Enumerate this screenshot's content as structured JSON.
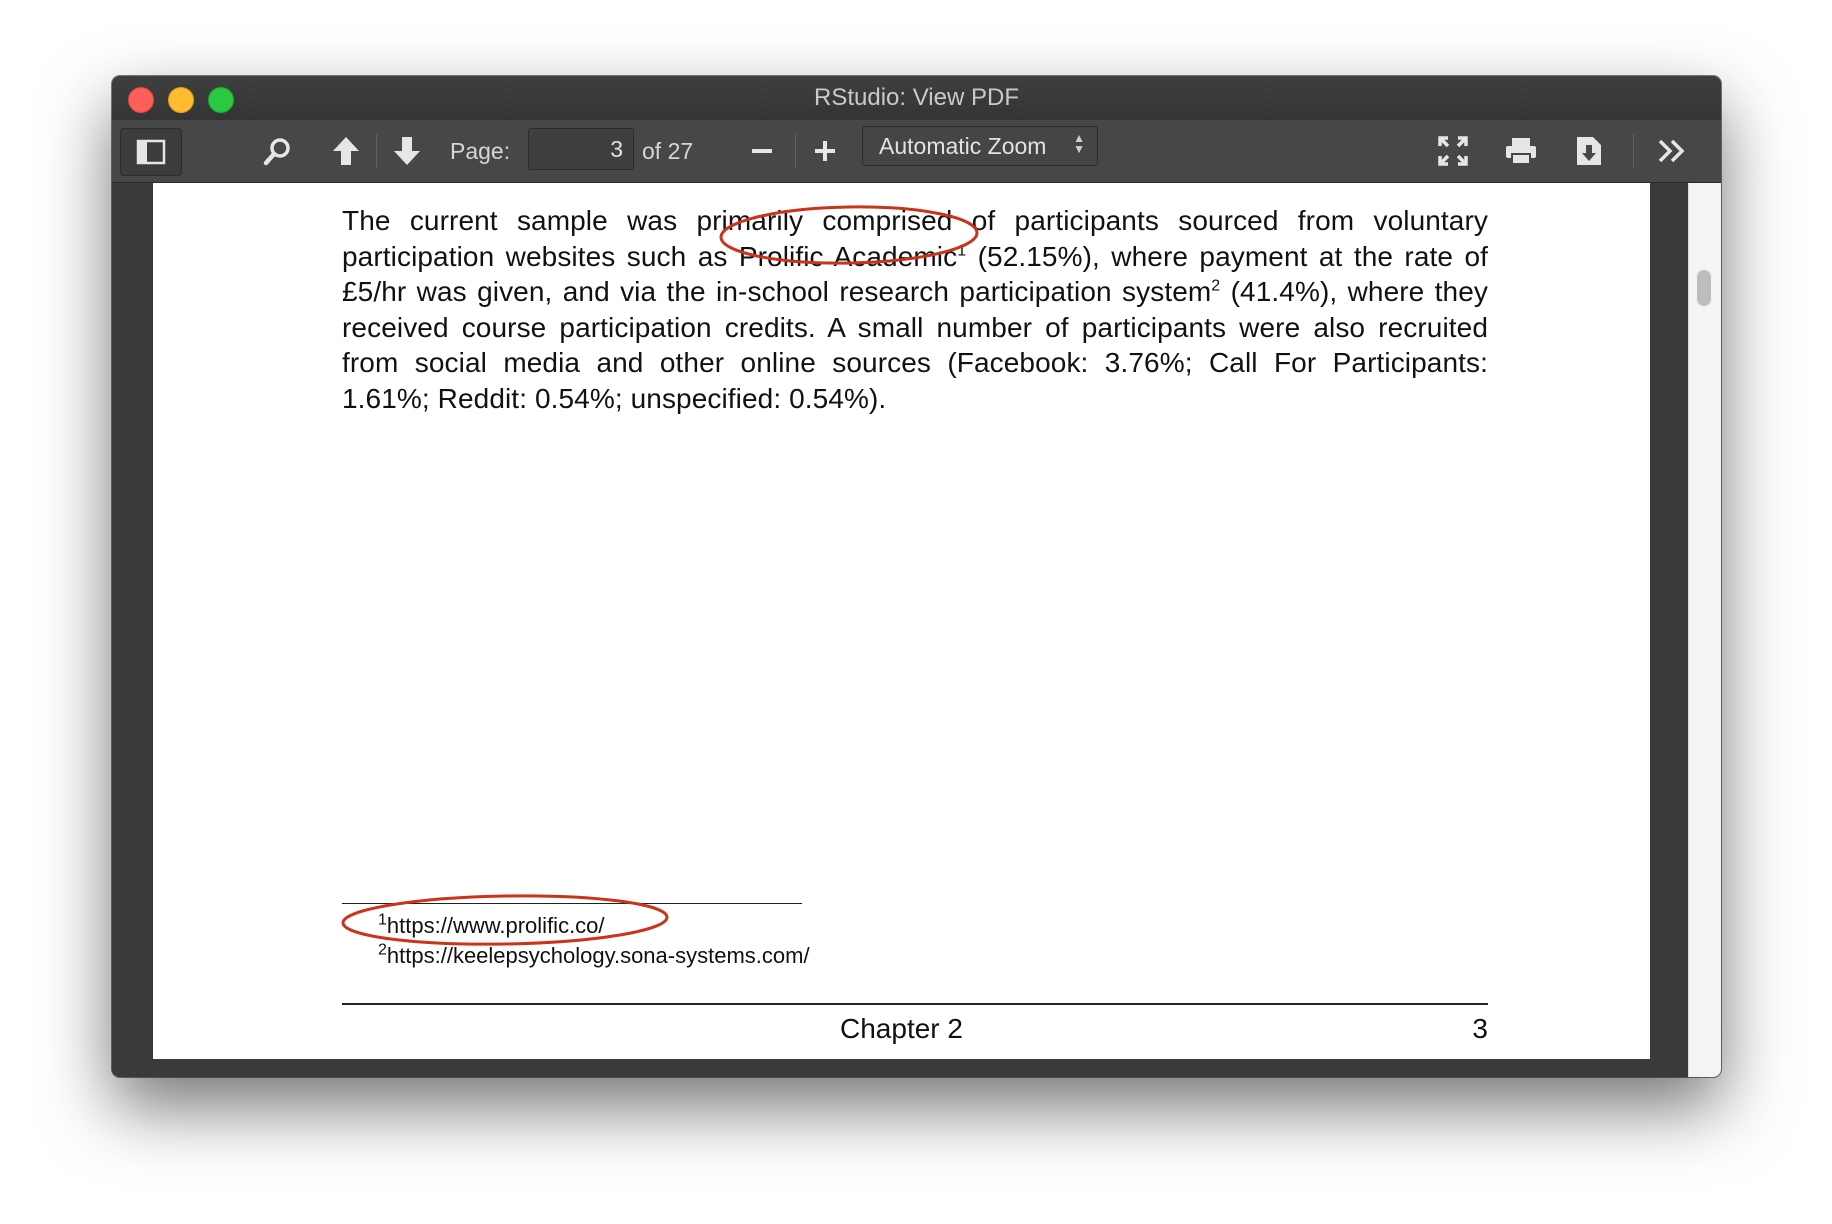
{
  "window": {
    "title": "RStudio: View PDF"
  },
  "toolbar": {
    "page_label": "Page:",
    "page_value": "3",
    "of_label": "of 27",
    "zoom_value": "Automatic Zoom"
  },
  "document": {
    "body": {
      "seg1": "The current sample was primarily comprised of participants sourced from voluntary participation websites such as ",
      "link1": "Prolific Academic",
      "sup1": "1",
      "seg2": " (52.15%), where payment at the rate of £5/hr was given, and via the in-school research participation system",
      "sup2": "2",
      "seg3": " (41.4%), where they received course participation credits. A small number of participants were also recruited from social media and other online sources (Facebook: 3.76%; Call For Participants: 1.61%; Reddit: 0.54%; unspecified: 0.54%)."
    },
    "footnotes": [
      {
        "mark": "1",
        "text": "https://www.prolific.co/"
      },
      {
        "mark": "2",
        "text": "https://keelepsychology.sona-systems.com/"
      }
    ],
    "footer": {
      "chapter": "Chapter 2",
      "page_number": "3"
    }
  },
  "annotations": {
    "color": "#c8341c"
  }
}
